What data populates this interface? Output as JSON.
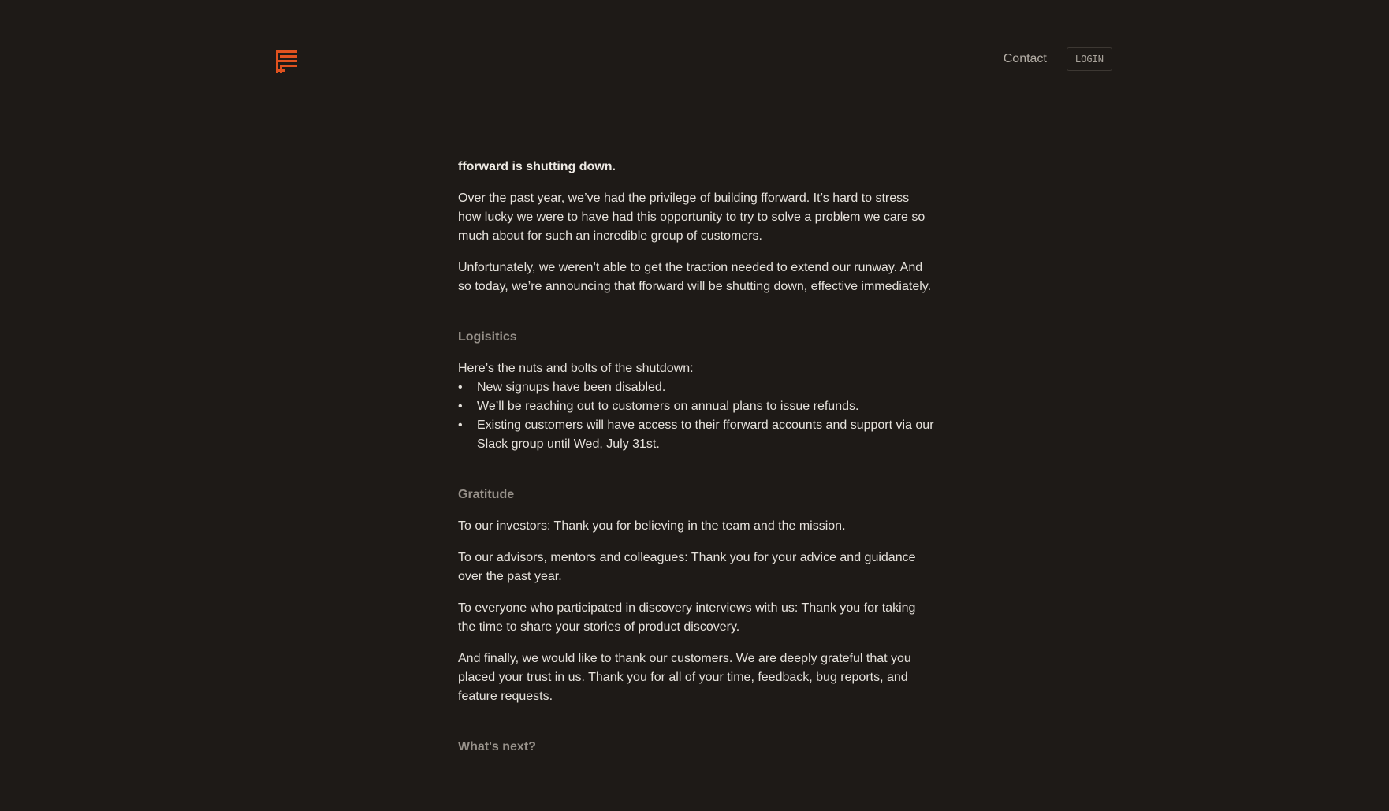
{
  "brand": {
    "logo_icon": "fforward-logo-icon",
    "accent_color": "#e0521f"
  },
  "nav": {
    "contact_label": "Contact",
    "login_label": "LOGIN"
  },
  "article": {
    "headline": "fforward is shutting down.",
    "intro_paragraphs": [
      "Over the past year, we’ve had the privilege of building fforward. It’s hard to stress how lucky we were to have had this opportunity to try to solve a problem we care so much about for such an incredible group of customers.",
      "Unfortunately, we weren’t able to get the traction needed to extend our runway. And so today, we’re announcing that fforward will be shutting down, effective immediately."
    ],
    "logistics": {
      "title": "Logisitics",
      "intro": "Here’s the nuts and bolts of the shutdown:",
      "items": [
        "New signups have been disabled.",
        "We’ll be reaching out to customers on annual plans to issue refunds.",
        "Existing customers will have access to their fforward accounts and support via our Slack group until Wed, July 31st."
      ]
    },
    "gratitude": {
      "title": "Gratitude",
      "paragraphs": [
        "To our investors: Thank you for believing in the team and the mission.",
        "To our advisors, mentors and colleagues: Thank you for your advice and guidance over the past year.",
        "To everyone who participated in discovery interviews with us: Thank you for taking the time to share your stories of product discovery.",
        "And finally, we would like to thank our customers. We are deeply grateful that you placed your trust in us. Thank you for all of your time, feedback, bug reports, and feature requests."
      ]
    },
    "whats_next": {
      "title": "What's next?"
    }
  }
}
